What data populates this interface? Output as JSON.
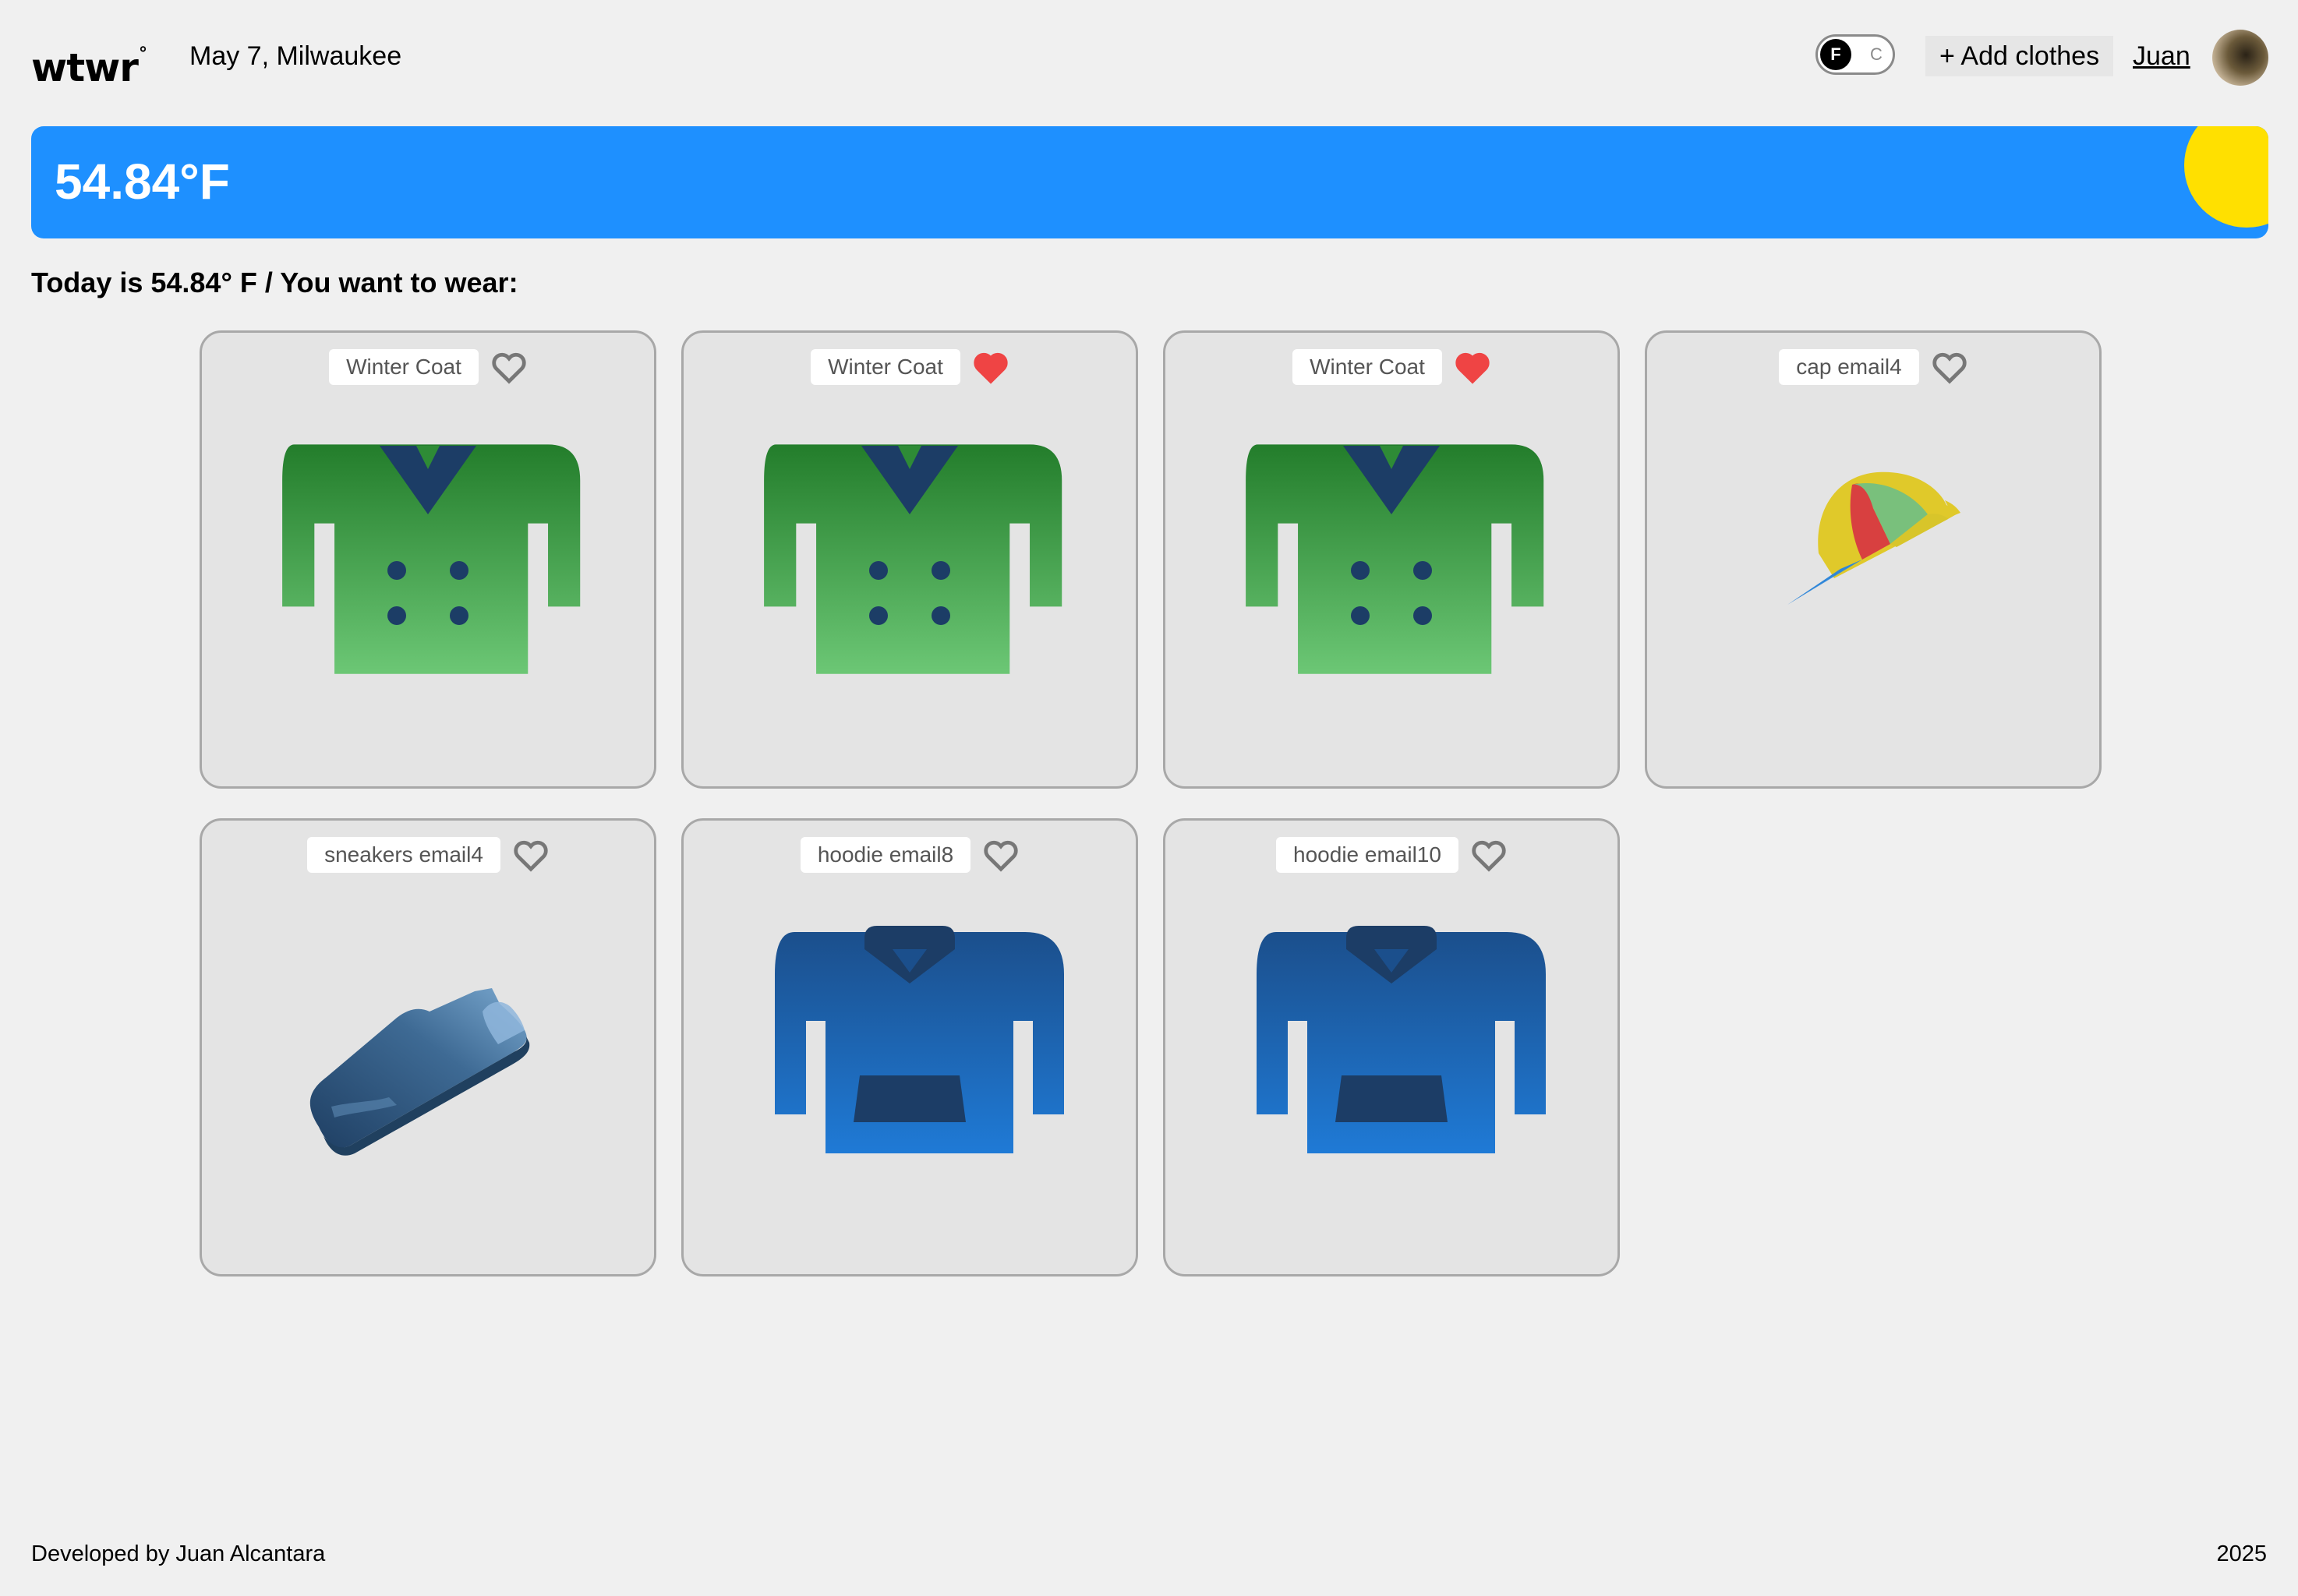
{
  "header": {
    "logo": "wtwr",
    "logo_mark": "°",
    "date_location": "May 7, Milwaukee",
    "unit_toggle": {
      "f_label": "F",
      "c_label": "C",
      "selected": "F"
    },
    "add_clothes_label": "+ Add clothes",
    "username": "Juan"
  },
  "weather": {
    "temperature_display": "54.84°F",
    "condition_icon": "sun-icon",
    "banner_color": "#1e90ff",
    "sun_color": "#ffe000"
  },
  "recommendation": {
    "text": "Today is 54.84° F / You want to wear:"
  },
  "items": [
    {
      "name": "Winter Coat",
      "liked": false,
      "icon": "winter-coat-icon"
    },
    {
      "name": "Winter Coat",
      "liked": true,
      "icon": "winter-coat-icon"
    },
    {
      "name": "Winter Coat",
      "liked": true,
      "icon": "winter-coat-icon"
    },
    {
      "name": "cap email4",
      "liked": false,
      "icon": "cap-icon"
    },
    {
      "name": "sneakers email4",
      "liked": false,
      "icon": "sneaker-icon"
    },
    {
      "name": "hoodie email8",
      "liked": false,
      "icon": "hoodie-icon"
    },
    {
      "name": "hoodie email10",
      "liked": false,
      "icon": "hoodie-icon"
    }
  ],
  "colors": {
    "liked_heart": "#ef4444",
    "coat_green": "#2e8b36",
    "hoodie_blue": "#1b4f8c"
  },
  "footer": {
    "credit": "Developed by Juan Alcantara",
    "year": "2025"
  }
}
